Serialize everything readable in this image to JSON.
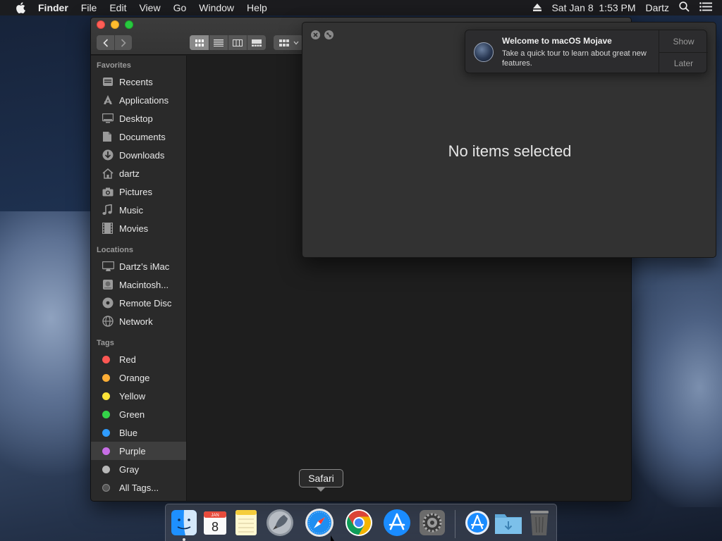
{
  "menubar": {
    "app_name": "Finder",
    "menus": [
      "File",
      "Edit",
      "View",
      "Go",
      "Window",
      "Help"
    ],
    "datetime": "Sat Jan 8  1:53 PM",
    "user": "Dartz"
  },
  "sidebar": {
    "favorites_heading": "Favorites",
    "favorites": [
      {
        "label": "Recents",
        "icon": "clock-icon"
      },
      {
        "label": "Applications",
        "icon": "applications-icon"
      },
      {
        "label": "Desktop",
        "icon": "desktop-icon"
      },
      {
        "label": "Documents",
        "icon": "document-icon"
      },
      {
        "label": "Downloads",
        "icon": "download-icon"
      },
      {
        "label": "dartz",
        "icon": "home-icon"
      },
      {
        "label": "Pictures",
        "icon": "camera-icon"
      },
      {
        "label": "Music",
        "icon": "music-note-icon"
      },
      {
        "label": "Movies",
        "icon": "film-icon"
      }
    ],
    "locations_heading": "Locations",
    "locations": [
      {
        "label": "Dartz’s iMac",
        "icon": "imac-icon"
      },
      {
        "label": "Macintosh...",
        "icon": "hard-drive-icon"
      },
      {
        "label": "Remote Disc",
        "icon": "disc-icon"
      },
      {
        "label": "Network",
        "icon": "globe-icon"
      }
    ],
    "tags_heading": "Tags",
    "tags": [
      {
        "label": "Red",
        "color": "#fc5753"
      },
      {
        "label": "Orange",
        "color": "#fdae36"
      },
      {
        "label": "Yellow",
        "color": "#fde338"
      },
      {
        "label": "Green",
        "color": "#34d449"
      },
      {
        "label": "Blue",
        "color": "#2f9cff"
      },
      {
        "label": "Purple",
        "color": "#c86ee6"
      },
      {
        "label": "Gray",
        "color": "#b8b8b8"
      },
      {
        "label": "All Tags...",
        "color": "#555555"
      }
    ],
    "selected_tag": "Purple"
  },
  "preview": {
    "message": "No items selected"
  },
  "notification": {
    "title": "Welcome to macOS Mojave",
    "body": "Take a quick tour to learn about great new features.",
    "show_label": "Show",
    "later_label": "Later"
  },
  "dock": {
    "tooltip": "Safari",
    "calendar_month": "JAN",
    "calendar_day": "8",
    "apps": [
      "finder-icon",
      "calendar-icon",
      "notes-icon",
      "launchpad-icon",
      "safari-icon",
      "chrome-icon",
      "app-store-icon",
      "system-preferences-icon",
      "app-store-download-icon",
      "downloads-folder-icon",
      "trash-icon"
    ]
  }
}
